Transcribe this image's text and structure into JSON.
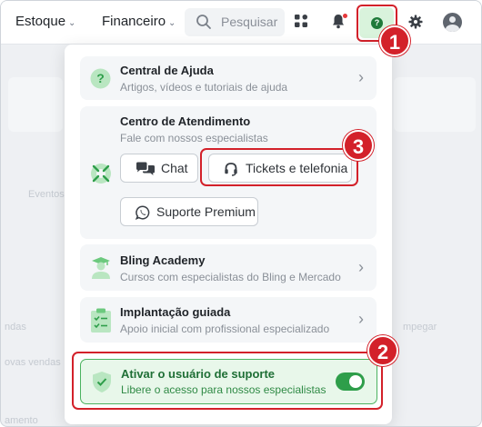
{
  "topbar": {
    "nav": [
      {
        "label": "Estoque"
      },
      {
        "label": "Financeiro"
      }
    ],
    "search": {
      "placeholder": "Pesquisar"
    }
  },
  "background": {
    "texts": [
      "Eventos",
      "ndas",
      "ovas vendas",
      "amento",
      "mpegar"
    ]
  },
  "menu": {
    "help_center": {
      "title": "Central de Ajuda",
      "subtitle": "Artigos, vídeos e tutoriais de ajuda"
    },
    "service_center": {
      "title": "Centro de Atendimento",
      "subtitle": "Fale com nossos especialistas",
      "buttons": {
        "chat": "Chat",
        "tickets": "Tickets e telefonia",
        "premium": "Suporte Premium"
      }
    },
    "academy": {
      "title": "Bling Academy",
      "subtitle": "Cursos com especialistas do Bling e Mercado"
    },
    "guided": {
      "title": "Implantação guiada",
      "subtitle": "Apoio inicial com profissional especializado"
    },
    "support_user": {
      "title": "Ativar o usuário de suporte",
      "subtitle": "Libere o acesso para nossos especialistas",
      "enabled": true
    }
  },
  "annotations": {
    "step1": "1",
    "step2": "2",
    "step3": "3",
    "color": "#d3212a"
  },
  "colors": {
    "brand_green": "#2e9e4a",
    "highlight_red": "#d3212a"
  }
}
